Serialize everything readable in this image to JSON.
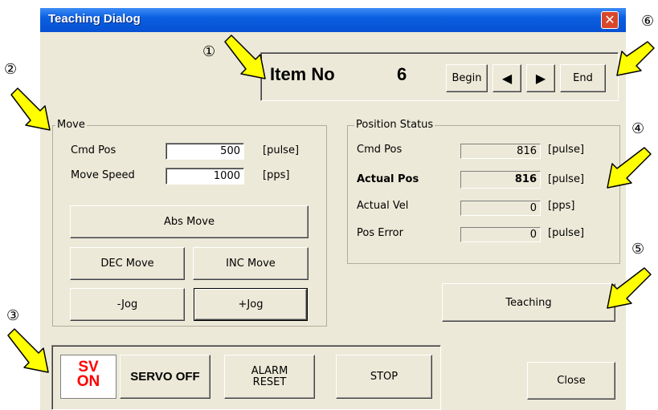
{
  "window": {
    "title": "Teaching Dialog",
    "close_glyph": "✕"
  },
  "item": {
    "label": "Item No",
    "value": "6",
    "begin": "Begin",
    "prev": "◀",
    "next": "▶",
    "end": "End"
  },
  "move": {
    "group_title": "Move",
    "cmd_pos_label": "Cmd Pos",
    "cmd_pos_value": "500",
    "cmd_pos_unit": "[pulse]",
    "speed_label": "Move Speed",
    "speed_value": "1000",
    "speed_unit": "[pps]",
    "abs_move": "Abs Move",
    "dec_move": "DEC Move",
    "inc_move": "INC Move",
    "jog_minus": "-Jog",
    "jog_plus": "+Jog"
  },
  "status": {
    "group_title": "Position Status",
    "rows": [
      {
        "label": "Cmd Pos",
        "value": "816",
        "unit": "[pulse]"
      },
      {
        "label": "Actual Pos",
        "value": "816",
        "unit": "[pulse]"
      },
      {
        "label": "Actual Vel",
        "value": "0",
        "unit": "[pps]"
      },
      {
        "label": "Pos Error",
        "value": "0",
        "unit": "[pulse]"
      }
    ]
  },
  "teaching": "Teaching",
  "servo": {
    "sv": "SV",
    "on": "ON",
    "servo_off": "SERVO OFF",
    "alarm_reset_1": "ALARM",
    "alarm_reset_2": "RESET",
    "stop": "STOP"
  },
  "close": "Close",
  "callouts": [
    "①",
    "②",
    "③",
    "④",
    "⑤",
    "⑥"
  ],
  "colors": {
    "title_bar": "#0751d3",
    "dialog_bg": "#ece9d8",
    "arrow_fill": "#ffff00",
    "servo_on_text": "#ff0000"
  }
}
